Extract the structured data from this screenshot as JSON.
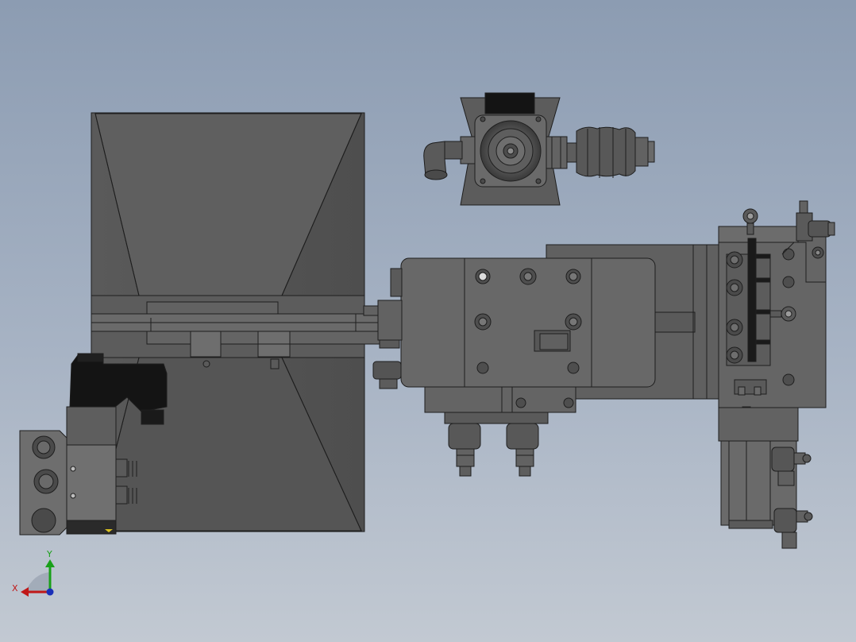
{
  "colors": {
    "background_top": "#8c9cb2",
    "background_bottom": "#c2c9d2",
    "body_dark": "#585858",
    "body_mid": "#6b6b6b",
    "body_light": "#777777",
    "edge": "#1e1e1e",
    "black_part": "#141414",
    "axis_x": "#c01818",
    "axis_y": "#19a019",
    "axis_z": "#1a2fb8"
  },
  "triad": {
    "x_label": "X",
    "y_label": "Y"
  },
  "icons": {
    "orientation": "orientation-triad-icon"
  }
}
